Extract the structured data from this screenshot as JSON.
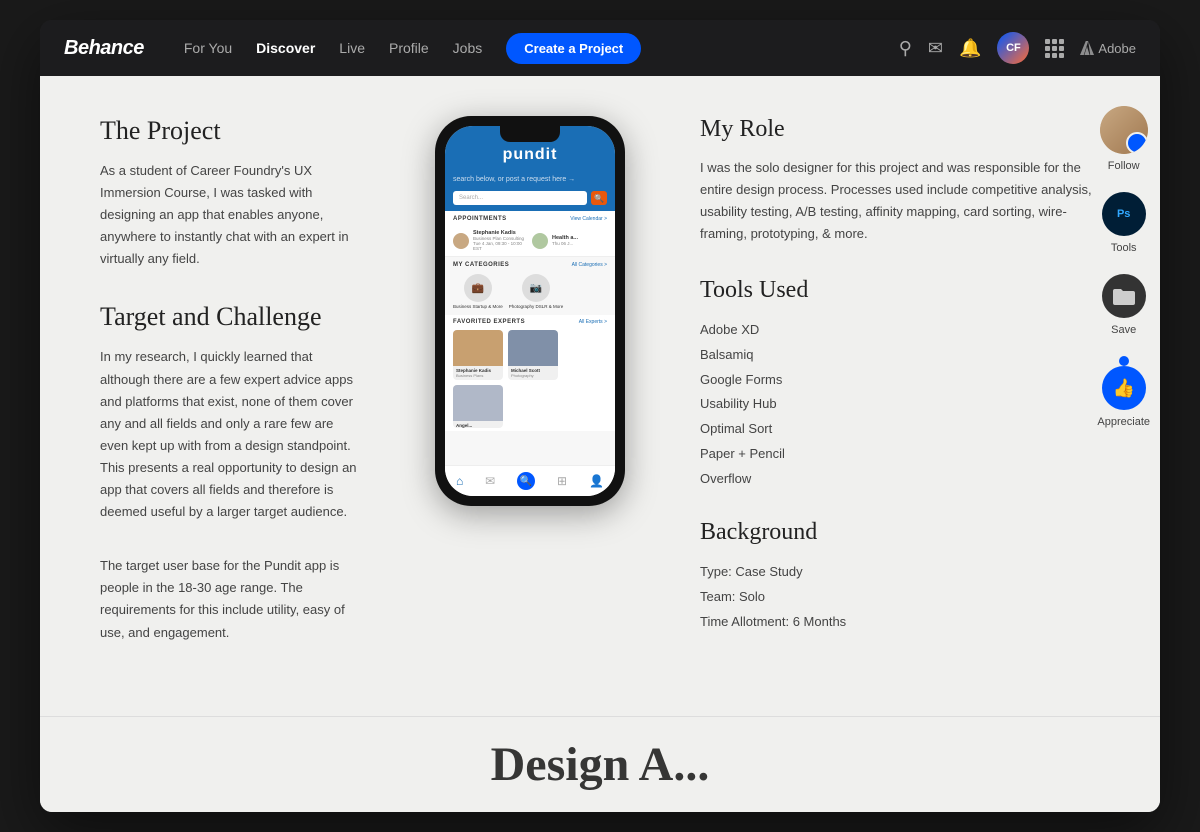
{
  "navbar": {
    "logo": "Behance",
    "nav_items": [
      {
        "label": "For You",
        "active": false
      },
      {
        "label": "Discover",
        "active": true
      },
      {
        "label": "Live",
        "active": false
      },
      {
        "label": "Profile",
        "active": false
      },
      {
        "label": "Jobs",
        "active": false
      }
    ],
    "create_btn": "Create a Project",
    "avatar_initials": "CF",
    "adobe_label": "Adobe"
  },
  "project": {
    "left": {
      "section1_title": "The Project",
      "section1_body": "As a student of Career Foundry's UX Immersion Course, I was tasked with designing an app that enables anyone, anywhere to instantly chat with an expert in virtually any field.",
      "section2_title": "Target and Challenge",
      "section2_body1": "In my research, I quickly learned that although there are a few expert advice apps and platforms that exist, none of them cover any and all fields and only a rare few are even kept up with from a design standpoint. This presents a real opportunity to design an app that covers all fields and therefore is deemed useful by a larger target audience.",
      "section2_body2": "The target user base for the Pundit app is people in the 18-30 age range. The requirements for this include utility, easy of use, and engagement."
    },
    "phone": {
      "logo": "pundit",
      "subbar_text": "search below, or post a request here →",
      "search_placeholder": "Search...",
      "appointments_label": "APPOINTMENTS",
      "appointments_link": "View Calendar >",
      "appt1_name": "Stephanie Kadis",
      "appt1_sub": "Business Plan Consulting\nTue 4 Jan, 09:30 - 10:00 EST",
      "appt2_name": "Health a...",
      "appt2_sub": "Thu 06 J...",
      "my_categories_label": "MY CATEGORIES",
      "all_categories_link": "All Categories >",
      "cat1_label": "Business\nStartup & More",
      "cat2_label": "Photography\nDSLR & More",
      "favorited_experts_label": "FAVORITED EXPERTS",
      "all_experts_link": "All Experts >",
      "expert1_name": "Stephanie Kadis",
      "expert1_sub": "Business Plans",
      "expert2_name": "Michael Scott",
      "expert2_sub": "Photography",
      "expert3_name": "Angel..."
    },
    "right": {
      "my_role_title": "My Role",
      "my_role_body": "I was the solo designer for this project and was responsible for the entire design process. Processes used include competitive analysis, usability testing, A/B testing, affinity mapping, card sorting, wire-framing, prototyping, & more.",
      "tools_title": "Tools Used",
      "tools": [
        "Adobe XD",
        "Balsamiq",
        "Google Forms",
        "Usability Hub",
        "Optimal Sort",
        "Paper + Pencil",
        "Overflow"
      ],
      "background_title": "Background",
      "background_type": "Type: Case Study",
      "background_team": "Team: Solo",
      "background_time": "Time Allotment: 6 Months"
    },
    "sidebar": {
      "follow_label": "Follow",
      "tools_label": "Tools",
      "save_label": "Save",
      "appreciate_label": "Appreciate"
    }
  },
  "bottom_teaser": "Design A..."
}
